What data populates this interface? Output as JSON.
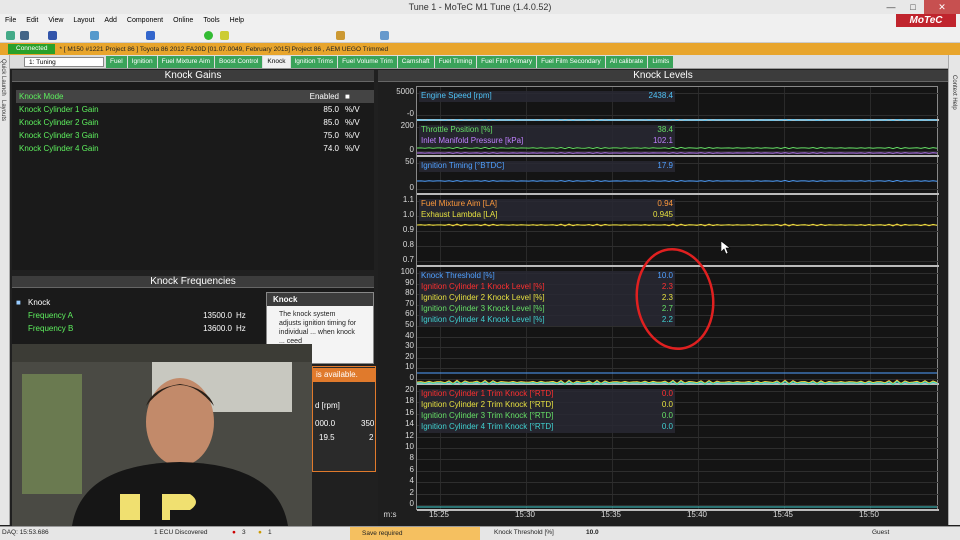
{
  "window": {
    "title": "Tune 1 - MoTeC M1 Tune (1.4.0.52)",
    "logo": "MoTeC"
  },
  "menu": [
    "File",
    "Edit",
    "View",
    "Layout",
    "Add",
    "Component",
    "Online",
    "Tools",
    "Help"
  ],
  "status": {
    "connected": "Connected",
    "info": "* [ M150 #1221 Project 86 ]  Toyota 86 2012 FA20D [01.07.0049, February 2015] Project 86 , AEM UEGO Trimmed"
  },
  "workspace": {
    "selected": "1: Tuning"
  },
  "tabs": [
    "Fuel",
    "Ignition",
    "Fuel Mixture Aim",
    "Boost Control",
    "Knock",
    "Ignition Trims",
    "Fuel Volume Trim",
    "Camshaft",
    "Fuel Timing",
    "Fuel Film Primary",
    "Fuel Film Secondary",
    "All calibrate",
    "Limits"
  ],
  "side": {
    "left1": "Quick Launch",
    "left2": "Layouts",
    "right": "Context Help"
  },
  "knock_gains": {
    "title": "Knock Gains",
    "header": {
      "label": "Knock Mode",
      "value": "Enabled"
    },
    "rows": [
      {
        "label": "Knock Cylinder 1 Gain",
        "value": "85.0",
        "unit": "%/V"
      },
      {
        "label": "Knock Cylinder 2 Gain",
        "value": "85.0",
        "unit": "%/V"
      },
      {
        "label": "Knock Cylinder 3 Gain",
        "value": "75.0",
        "unit": "%/V"
      },
      {
        "label": "Knock Cylinder 4 Gain",
        "value": "74.0",
        "unit": "%/V"
      }
    ]
  },
  "knock_freq": {
    "title": "Knock Frequencies",
    "group": "Knock",
    "rows": [
      {
        "label": "Frequency A",
        "value": "13500.0",
        "unit": "Hz"
      },
      {
        "label": "Frequency B",
        "value": "13600.0",
        "unit": "Hz"
      }
    ]
  },
  "help": {
    "title": "Knock",
    "text": "The knock system adjusts ignition timing for individual ... when knock ... ceed"
  },
  "overlay": {
    "available": "is available.",
    "rpm": "d [rpm]",
    "v1": "000.0",
    "v2": "350",
    "v3": "19.5",
    "v4": "2"
  },
  "knock_levels": {
    "title": "Knock Levels",
    "channels": [
      {
        "name": "Engine Speed [rpm]",
        "value": "2438.4",
        "color": "#4fc3f7"
      },
      {
        "name": "Throttle Position [%]",
        "value": "38.4",
        "color": "#66e066"
      },
      {
        "name": "Inlet Manifold Pressure [kPa]",
        "value": "102.1",
        "color": "#c080ff"
      },
      {
        "name": "Ignition Timing [°BTDC]",
        "value": "17.9",
        "color": "#4fa0ff"
      },
      {
        "name": "Fuel Mixture Aim [LA]",
        "value": "0.94",
        "color": "#ff9a3c"
      },
      {
        "name": "Exhaust Lambda [LA]",
        "value": "0.945",
        "color": "#e6e040"
      },
      {
        "name": "Knock Threshold [%]",
        "value": "10.0",
        "color": "#4fa0ff"
      },
      {
        "name": "Ignition Cylinder 1 Knock Level [%]",
        "value": "2.3",
        "color": "#ff3030"
      },
      {
        "name": "Ignition Cylinder 2 Knock Level [%]",
        "value": "2.3",
        "color": "#e6e040"
      },
      {
        "name": "Ignition Cylinder 3 Knock Level [%]",
        "value": "2.7",
        "color": "#66e066"
      },
      {
        "name": "Ignition Cylinder 4 Knock Level [%]",
        "value": "2.2",
        "color": "#40d0d0"
      },
      {
        "name": "Ignition Cylinder 1 Trim Knock [°RTD]",
        "value": "0.0",
        "color": "#ff3030"
      },
      {
        "name": "Ignition Cylinder 2 Trim Knock [°RTD]",
        "value": "0.0",
        "color": "#e6e040"
      },
      {
        "name": "Ignition Cylinder 3 Trim Knock [°RTD]",
        "value": "0.0",
        "color": "#66e066"
      },
      {
        "name": "Ignition Cylinder 4 Trim Knock [°RTD]",
        "value": "0.0",
        "color": "#40d0d0"
      }
    ],
    "ticks": {
      "s1": [
        "5000",
        "-0"
      ],
      "s2": [
        "200",
        "0"
      ],
      "s3": [
        "50",
        "0"
      ],
      "s4": [
        "1.1",
        "1.0",
        "0.9",
        "0.8",
        "0.7"
      ],
      "s5": [
        "100",
        "90",
        "80",
        "70",
        "60",
        "50",
        "40",
        "30",
        "20",
        "10",
        "0"
      ],
      "s6": [
        "20",
        "18",
        "16",
        "14",
        "12",
        "10",
        "8",
        "6",
        "4",
        "2",
        "0"
      ]
    },
    "xaxis": {
      "unit": "m:s",
      "labels": [
        "15:25",
        "15:30",
        "15:35",
        "15:40",
        "15:45",
        "15:50"
      ]
    }
  },
  "bottom": {
    "daq": "DAQ: 15:53.686",
    "ecu": "1 ECU Discovered",
    "err": "3",
    "warn": "1",
    "save": "Save required",
    "chan": "Knock Threshold [%]",
    "chanval": "10.0",
    "user": "Guest"
  }
}
